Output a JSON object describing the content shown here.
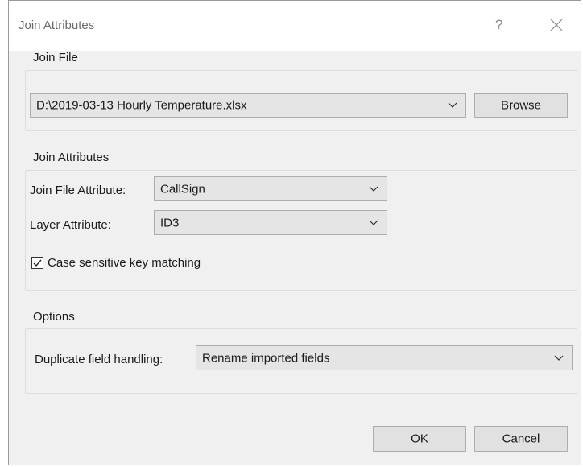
{
  "window": {
    "title": "Join Attributes",
    "help_label": "?"
  },
  "join_file": {
    "group_title": "Join File",
    "file_value": "D:\\2019-03-13 Hourly Temperature.xlsx",
    "browse_label": "Browse"
  },
  "join_attributes": {
    "group_title": "Join Attributes",
    "join_file_attribute_label": "Join File Attribute:",
    "join_file_attribute_value": "CallSign",
    "layer_attribute_label": "Layer Attribute:",
    "layer_attribute_value": "ID3",
    "case_sensitive_label": "Case sensitive key matching",
    "case_sensitive_checked": true
  },
  "options": {
    "group_title": "Options",
    "duplicate_handling_label": "Duplicate field handling:",
    "duplicate_handling_value": "Rename imported fields"
  },
  "footer": {
    "ok_label": "OK",
    "cancel_label": "Cancel"
  },
  "icons": {
    "close": "close-icon",
    "dropdown": "chevron-down-icon",
    "check": "check-icon"
  }
}
